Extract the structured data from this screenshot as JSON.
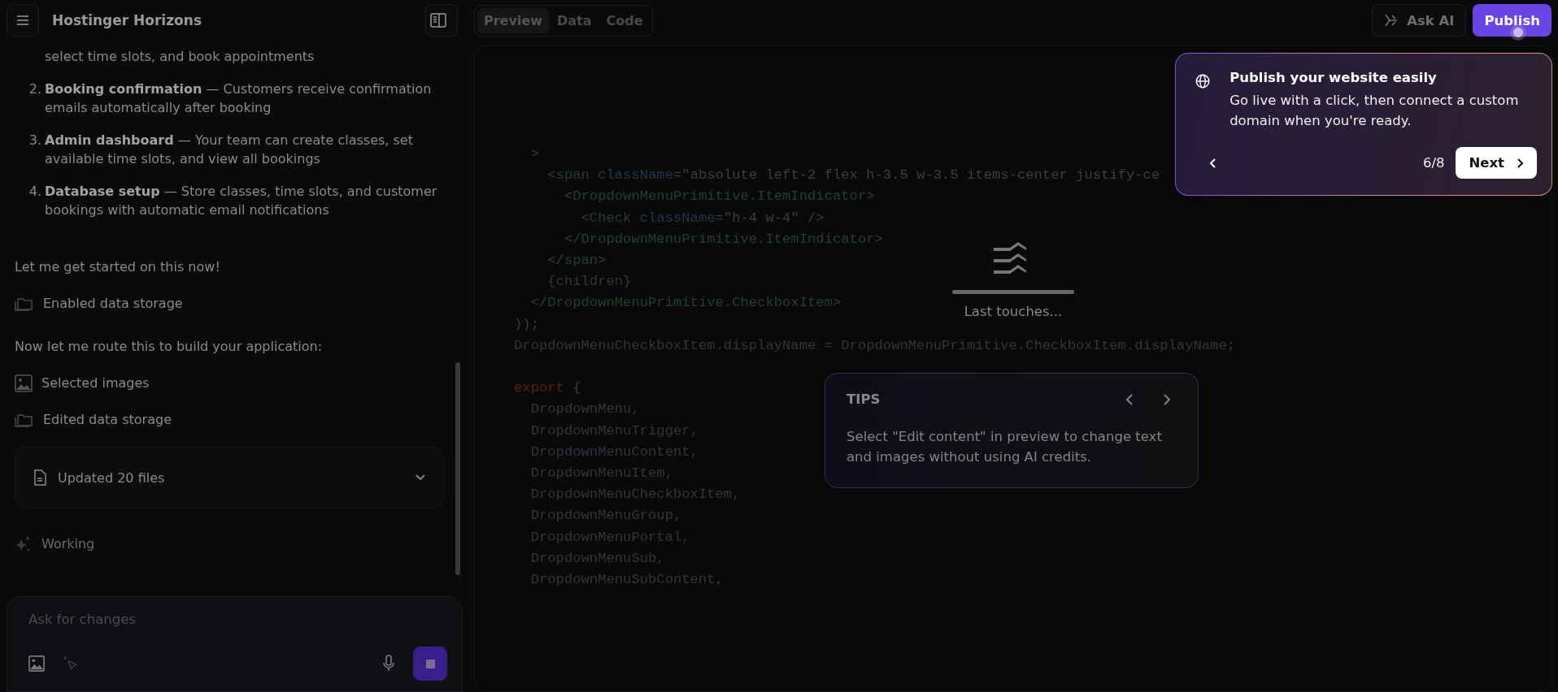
{
  "header": {
    "title": "Hostinger Horizons"
  },
  "chat": {
    "list_continuation": "select time slots, and book appointments",
    "steps": [
      {
        "number": "2.",
        "title": "Booking confirmation",
        "text": "— Customers receive confirmation emails automatically after booking"
      },
      {
        "number": "3.",
        "title": "Admin dashboard",
        "text": "— Your team can create classes, set available time slots, and view all bookings"
      },
      {
        "number": "4.",
        "title": "Database setup",
        "text": "— Store classes, time slots, and customer bookings with automatic email notifications"
      }
    ],
    "messages": [
      {
        "kind": "text",
        "text": "Let me get started on this now!"
      },
      {
        "kind": "storage_action",
        "text": "Enabled data storage"
      },
      {
        "kind": "text",
        "text": "Now let me route this to build your application:"
      },
      {
        "kind": "image_action",
        "text": "Selected images"
      },
      {
        "kind": "storage_action",
        "text": "Edited data storage"
      },
      {
        "kind": "files_card",
        "text": "Updated 20 files",
        "expanded": false
      },
      {
        "kind": "status",
        "text": "Working"
      }
    ],
    "input": {
      "placeholder": "Ask for changes"
    }
  },
  "tabs": [
    {
      "label": "Preview",
      "selected": true
    },
    {
      "label": "Data",
      "selected": false
    },
    {
      "label": "Code",
      "selected": false
    }
  ],
  "actions": {
    "ask_ai": "Ask AI",
    "publish": "Publish"
  },
  "code": [
    {
      "tokens": [
        {
          "text": "  >",
          "kind": "punct"
        }
      ]
    },
    {
      "tokens": [
        {
          "text": "    <",
          "kind": "punct"
        },
        {
          "text": "span",
          "kind": "tag"
        },
        {
          "text": " className",
          "kind": "attr"
        },
        {
          "text": "=",
          "kind": "punct"
        },
        {
          "text": "\"absolute left-2 flex h-3.5 w-3.5 items-center justify-ce",
          "kind": "str"
        }
      ]
    },
    {
      "tokens": [
        {
          "text": "      <",
          "kind": "punct"
        },
        {
          "text": "DropdownMenuPrimitive.ItemIndicator",
          "kind": "tag"
        },
        {
          "text": ">",
          "kind": "punct"
        }
      ]
    },
    {
      "tokens": [
        {
          "text": "        <",
          "kind": "punct"
        },
        {
          "text": "Check",
          "kind": "tag"
        },
        {
          "text": " className",
          "kind": "attr"
        },
        {
          "text": "=",
          "kind": "punct"
        },
        {
          "text": "\"h-4 w-4\"",
          "kind": "str"
        },
        {
          "text": " />",
          "kind": "punct"
        }
      ]
    },
    {
      "tokens": [
        {
          "text": "      </",
          "kind": "punct"
        },
        {
          "text": "DropdownMenuPrimitive.ItemIndicator",
          "kind": "tag"
        },
        {
          "text": ">",
          "kind": "punct"
        }
      ]
    },
    {
      "tokens": [
        {
          "text": "    </",
          "kind": "punct"
        },
        {
          "text": "span",
          "kind": "tag"
        },
        {
          "text": ">",
          "kind": "punct"
        }
      ]
    },
    {
      "tokens": [
        {
          "text": "    {children}",
          "kind": "plain"
        }
      ]
    },
    {
      "tokens": [
        {
          "text": "  </",
          "kind": "punct"
        },
        {
          "text": "DropdownMenuPrimitive.CheckboxItem",
          "kind": "tag"
        },
        {
          "text": ">",
          "kind": "punct"
        }
      ]
    },
    {
      "tokens": [
        {
          "text": "));",
          "kind": "punct"
        }
      ]
    },
    {
      "tokens": [
        {
          "text": "DropdownMenuCheckboxItem.displayName = DropdownMenuPrimitive.CheckboxItem.displayName;",
          "kind": "plain"
        }
      ]
    },
    {
      "kind": "blank"
    },
    {
      "tokens": [
        {
          "text": "export",
          "kind": "kw"
        },
        {
          "text": " {",
          "kind": "punct"
        }
      ]
    },
    {
      "tokens": [
        {
          "text": "  DropdownMenu,",
          "kind": "plain"
        }
      ]
    },
    {
      "tokens": [
        {
          "text": "  DropdownMenuTrigger,",
          "kind": "plain"
        }
      ]
    },
    {
      "tokens": [
        {
          "text": "  DropdownMenuContent,",
          "kind": "plain"
        }
      ]
    },
    {
      "tokens": [
        {
          "text": "  DropdownMenuItem,",
          "kind": "plain"
        }
      ]
    },
    {
      "tokens": [
        {
          "text": "  DropdownMenuCheckboxItem,",
          "kind": "plain"
        }
      ]
    },
    {
      "tokens": [
        {
          "text": "  DropdownMenuGroup,",
          "kind": "plain"
        }
      ]
    },
    {
      "tokens": [
        {
          "text": "  DropdownMenuPortal,",
          "kind": "plain"
        }
      ]
    },
    {
      "tokens": [
        {
          "text": "  DropdownMenuSub,",
          "kind": "plain"
        }
      ]
    },
    {
      "tokens": [
        {
          "text": "  DropdownMenuSubContent,",
          "kind": "plain"
        }
      ]
    }
  ],
  "loader": {
    "text": "Last touches...",
    "level": 1
  },
  "tips": {
    "title": "TIPS",
    "text": "Select \"Edit content\" in preview to change text and images without using AI credits."
  },
  "tour": {
    "title": "Publish your website easily",
    "text": "Go live with a click, then connect a custom domain when you're ready.",
    "counter": "6/8",
    "next": "Next"
  }
}
